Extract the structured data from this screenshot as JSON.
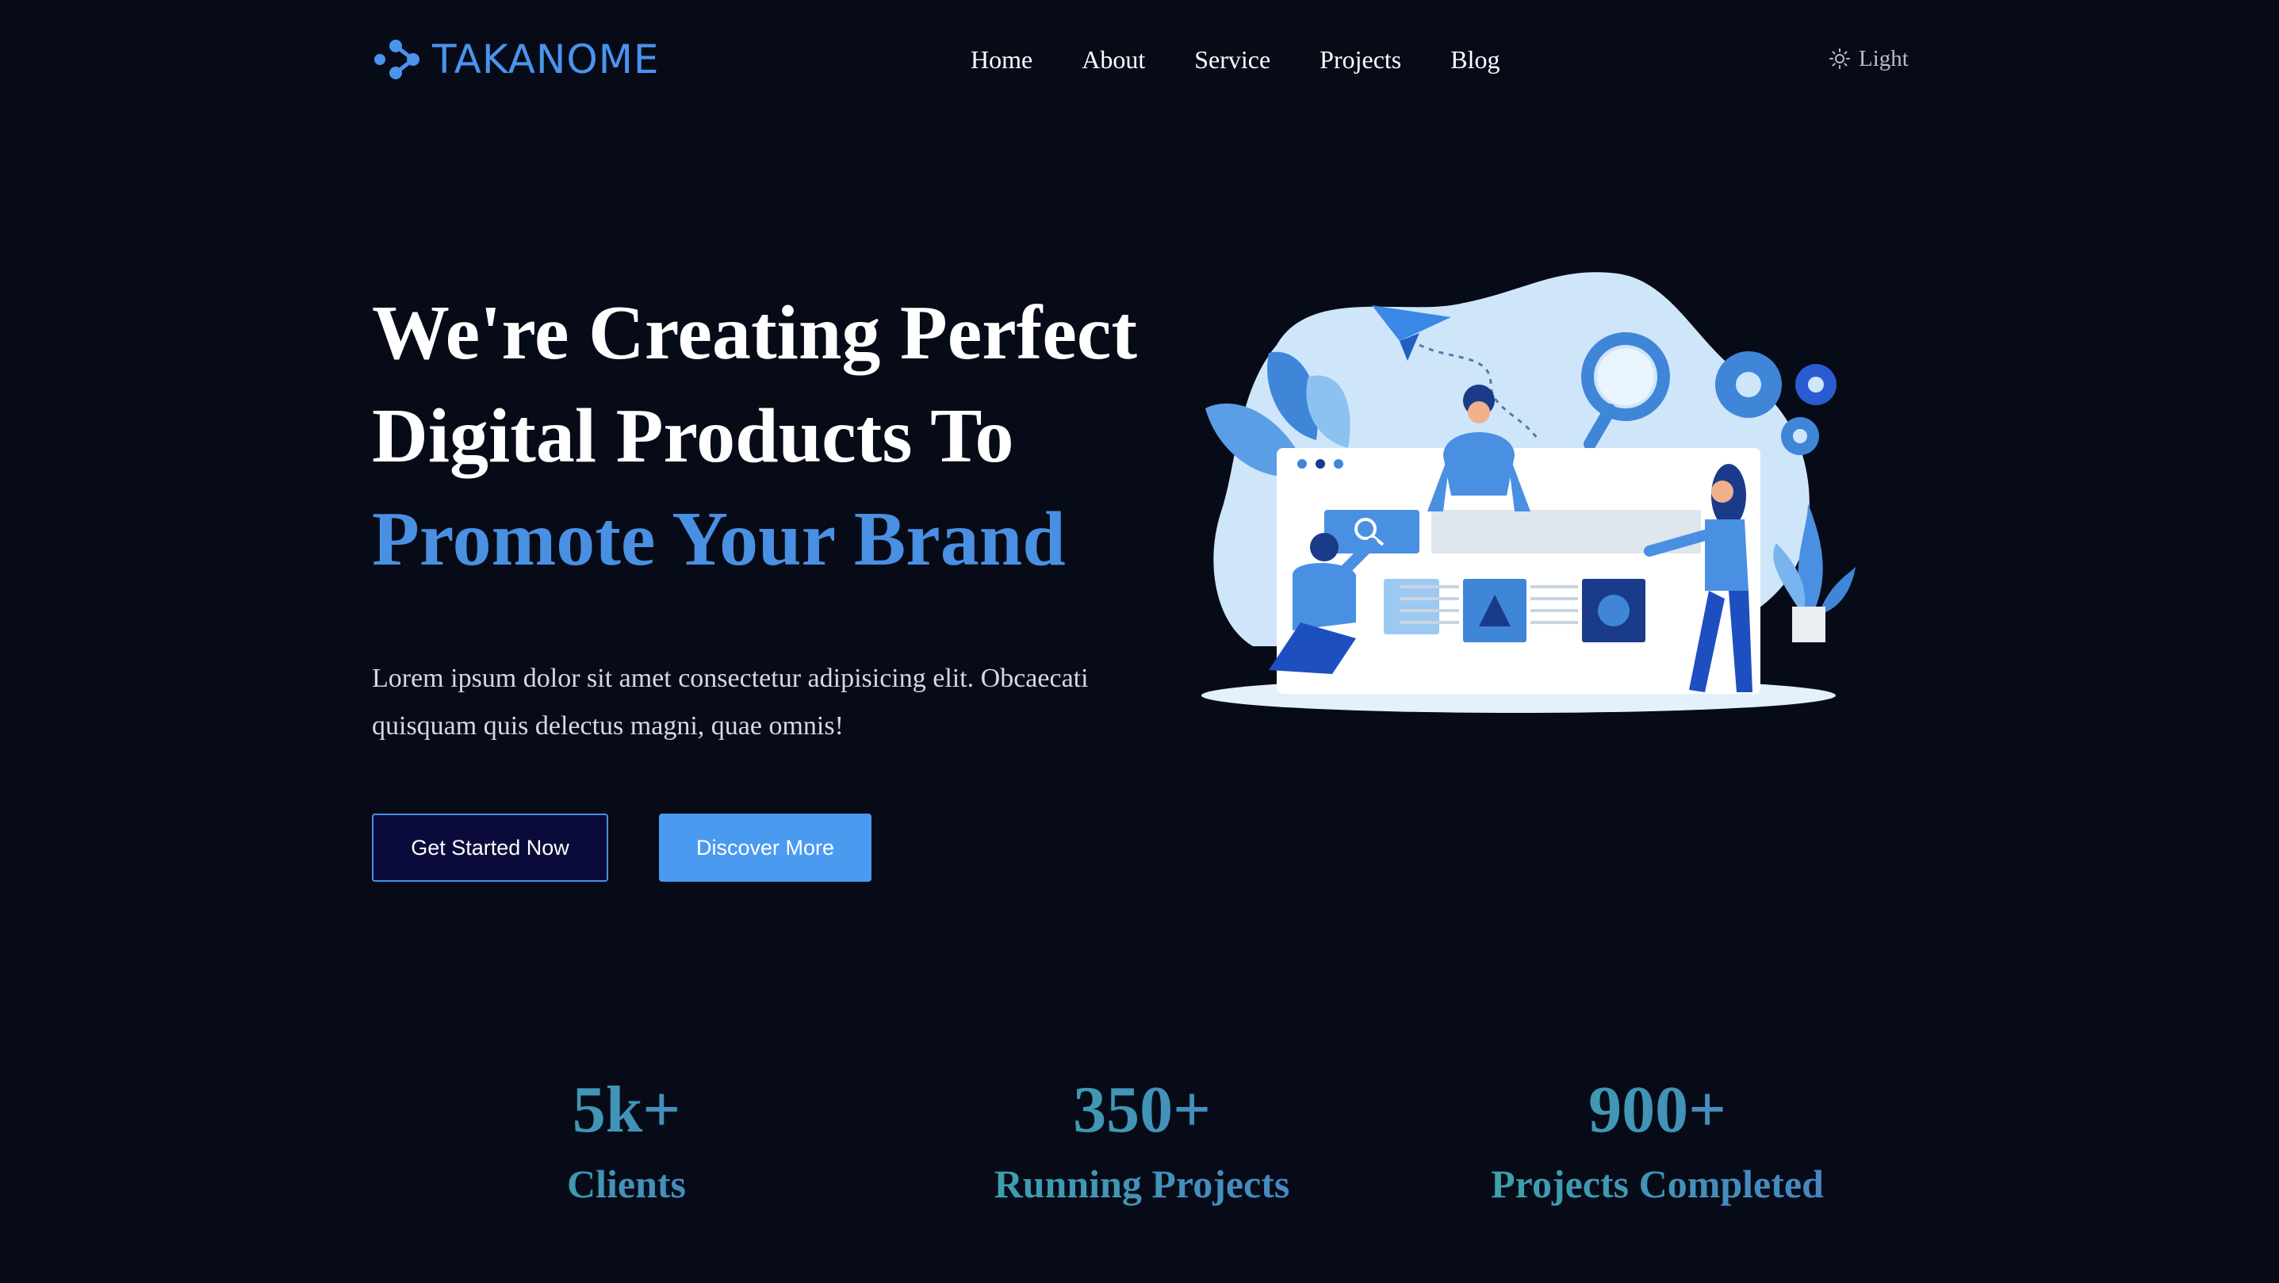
{
  "brand": {
    "name": "TAKANOME",
    "logo_icon": "molecule-dots-icon",
    "accent": "#4a94ee"
  },
  "nav": {
    "items": [
      {
        "label": "Home"
      },
      {
        "label": "About"
      },
      {
        "label": "Service"
      },
      {
        "label": "Projects"
      },
      {
        "label": "Blog"
      }
    ]
  },
  "theme_toggle": {
    "label": "Light",
    "icon": "sun-icon"
  },
  "hero": {
    "title_line1": "We're Creating Perfect",
    "title_line2": "Digital Products To",
    "title_accent": "Promote Your Brand",
    "description": "Lorem ipsum dolor sit amet consectetur adipisicing elit. Obcaecati quisquam quis delectus magni, quae omnis!",
    "primary_button": "Get Started Now",
    "secondary_button": "Discover More",
    "illustration": "team-building-website-illustration"
  },
  "stats": [
    {
      "value": "5k+",
      "label": "Clients"
    },
    {
      "value": "350+",
      "label": "Running Projects"
    },
    {
      "value": "900+",
      "label": "Projects Completed"
    }
  ],
  "colors": {
    "background": "#070b18",
    "accent": "#4a90e2",
    "button_secondary": "#4a9af0"
  }
}
